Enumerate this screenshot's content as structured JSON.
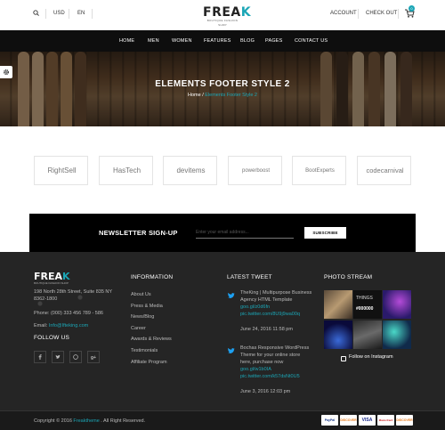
{
  "topbar": {
    "currency": "USD",
    "language": "EN",
    "account": "ACCOUNT",
    "checkout": "CHECK OUT",
    "cart_count": "0"
  },
  "logo": {
    "brand_main": "FREA",
    "brand_accent": "K",
    "tagline": "BOUTIQUE FASHION SHOP"
  },
  "nav": [
    "HOME",
    "MEN",
    "WOMEN",
    "FEATURES",
    "BLOG",
    "PAGES",
    "CONTACT US"
  ],
  "hero": {
    "title": "ELEMENTS FOOTER STYLE 2",
    "breadcrumb_home": "Home",
    "breadcrumb_sep": " / ",
    "breadcrumb_current": "Elements Footer Style 2"
  },
  "brands": [
    "RightSell",
    "HasTech",
    "devitems",
    "powerboost",
    "BootExperts",
    "codecarnival"
  ],
  "newsletter": {
    "title": "NEWSLETTER SIGN-UP",
    "placeholder": "Enter your email address...",
    "button": "SUBSCRIBE"
  },
  "footer": {
    "logo_main": "FREA",
    "logo_accent": "K",
    "logo_tagline": "BOUTIQUE FASHION SHOP",
    "address_line1": "198 North 28th Street, Suite 835 NY",
    "address_line2": "8362-1800",
    "phone": "Phone: (000) 333 456 789 - 586",
    "email_label": "Email:",
    "email": "Info@Ifteking.com",
    "follow_title": "FOLLOW US",
    "info_title": "INFORMATION",
    "info_links": [
      "About Us",
      "Press & Media",
      "News/Blog",
      "Career",
      "Awards & Reviews",
      "Testimonials",
      "Affiliate Program"
    ],
    "tweet_title": "LATEST TWEET",
    "tweets": [
      {
        "line1": "TheKing | Multipurpose Business",
        "line2": "Agency HTML Template",
        "link1": "goo.gl/z0d6fn",
        "link2": "pic.twitter.com/8U9j9wa00q",
        "date": "June 24, 2016 11:58 pm"
      },
      {
        "line1": "Bochas Responsive WordPress",
        "line2": "Theme for your online store",
        "line3": "here, purchase now",
        "link1": "goo.gl/w1b0IA",
        "link2": "pic.twitter.com/k57dsNt0U5",
        "date": "June 3, 2016 12:03 pm"
      }
    ],
    "photo_title": "PHOTO STREAM",
    "photo_overlay_things": "THINGS",
    "photo_overlay_code": "#000000",
    "instagram": "Follow on Instagram"
  },
  "copyright": {
    "prefix": "Copyright © 2016 ",
    "brand": "Freaktheme",
    "suffix": " . All Right Reserved."
  },
  "payments": [
    "PayPal",
    "DISCOVER",
    "VISA",
    "MasterCard",
    "DISCOVER"
  ],
  "colors": {
    "accent": "#1ba6b6",
    "dark": "#252525",
    "nav": "#0e0e0e"
  }
}
